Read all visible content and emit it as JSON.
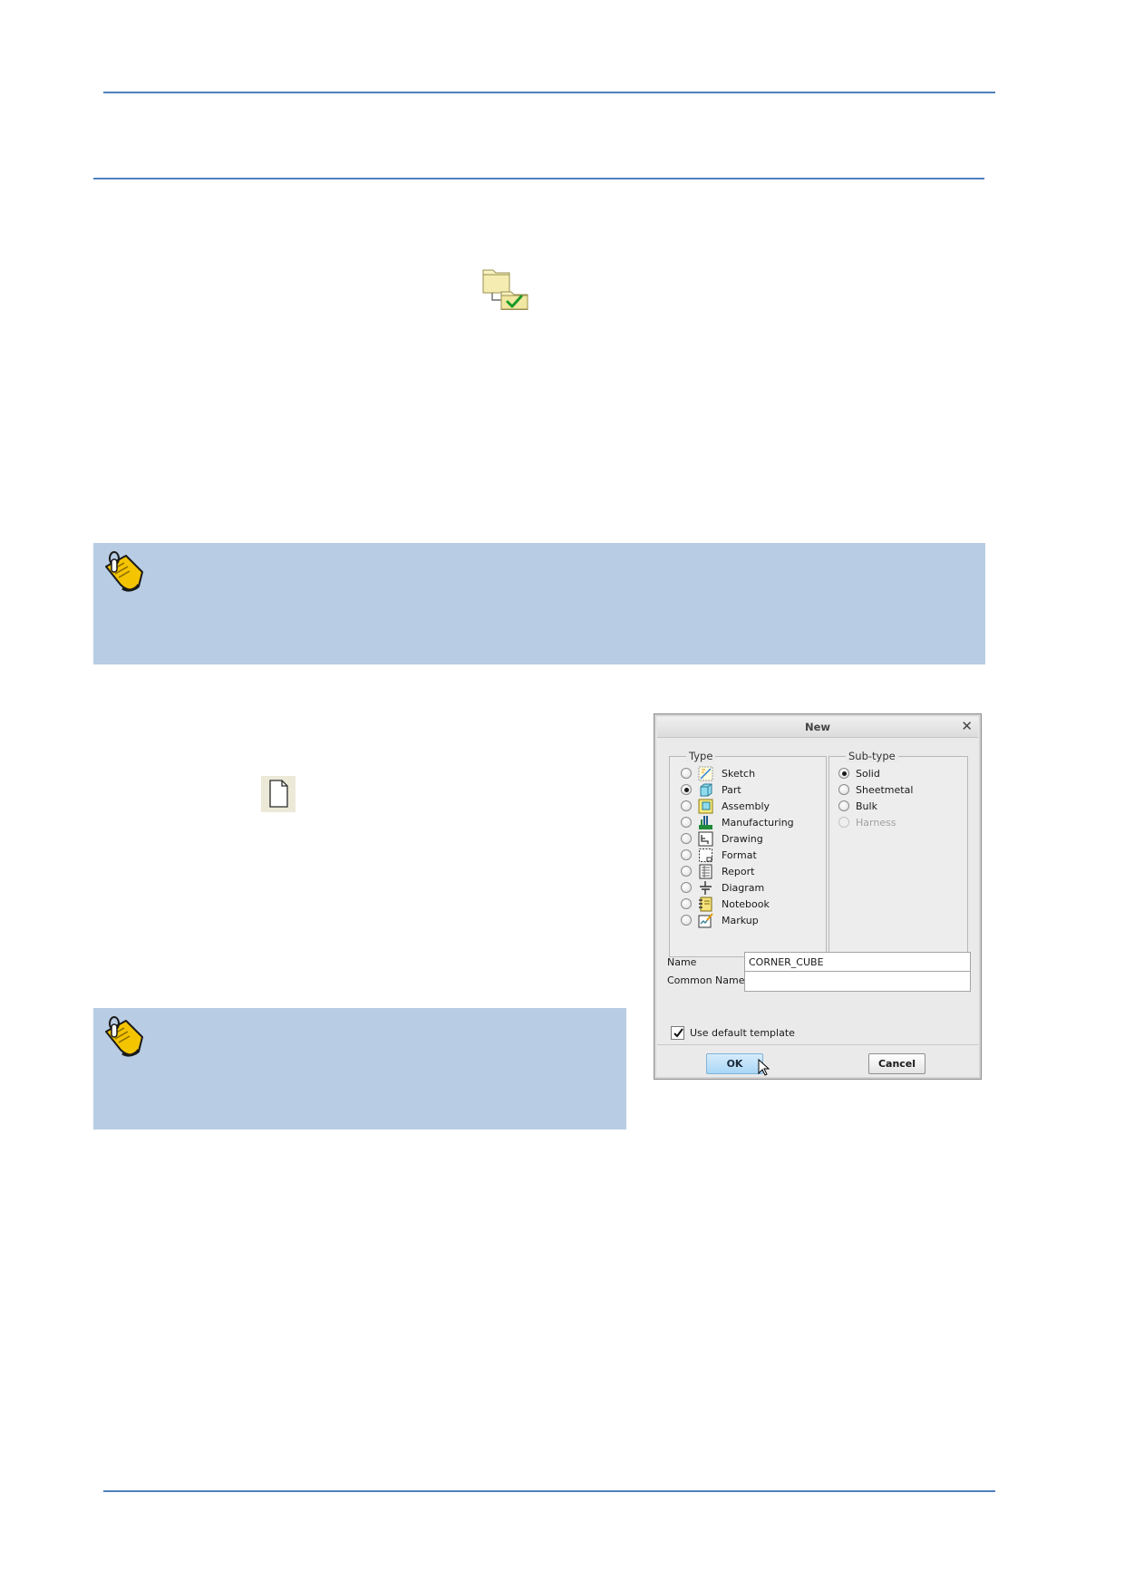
{
  "document": {
    "header_rule": "",
    "footer_rule": ""
  },
  "icons": {
    "folder_set": "folder-checkmark-icon",
    "new_file": "new-file-icon",
    "note": "note-pin-icon"
  },
  "colors": {
    "rule": "#4f81bd",
    "note_bg": "#b8cce4",
    "ok_button": "#a9d6f6"
  },
  "dialog": {
    "title": "New",
    "close": "✕",
    "type_group": {
      "legend": "Type",
      "options": [
        {
          "label": "Sketch",
          "icon": "sketch-icon",
          "selected": false
        },
        {
          "label": "Part",
          "icon": "part-icon",
          "selected": true
        },
        {
          "label": "Assembly",
          "icon": "assembly-icon",
          "selected": false
        },
        {
          "label": "Manufacturing",
          "icon": "manufacturing-icon",
          "selected": false
        },
        {
          "label": "Drawing",
          "icon": "drawing-icon",
          "selected": false
        },
        {
          "label": "Format",
          "icon": "format-icon",
          "selected": false
        },
        {
          "label": "Report",
          "icon": "report-icon",
          "selected": false
        },
        {
          "label": "Diagram",
          "icon": "diagram-icon",
          "selected": false
        },
        {
          "label": "Notebook",
          "icon": "notebook-icon",
          "selected": false
        },
        {
          "label": "Markup",
          "icon": "markup-icon",
          "selected": false
        }
      ]
    },
    "subtype_group": {
      "legend": "Sub-type",
      "options": [
        {
          "label": "Solid",
          "selected": true,
          "enabled": true
        },
        {
          "label": "Sheetmetal",
          "selected": false,
          "enabled": true
        },
        {
          "label": "Bulk",
          "selected": false,
          "enabled": true
        },
        {
          "label": "Harness",
          "selected": false,
          "enabled": false
        }
      ]
    },
    "name_label": "Name",
    "name_value": "CORNER_CUBE",
    "common_name_label": "Common Name",
    "common_name_value": "",
    "use_default_template_label": "Use default template",
    "use_default_template_checked": true,
    "ok_label": "OK",
    "cancel_label": "Cancel"
  }
}
